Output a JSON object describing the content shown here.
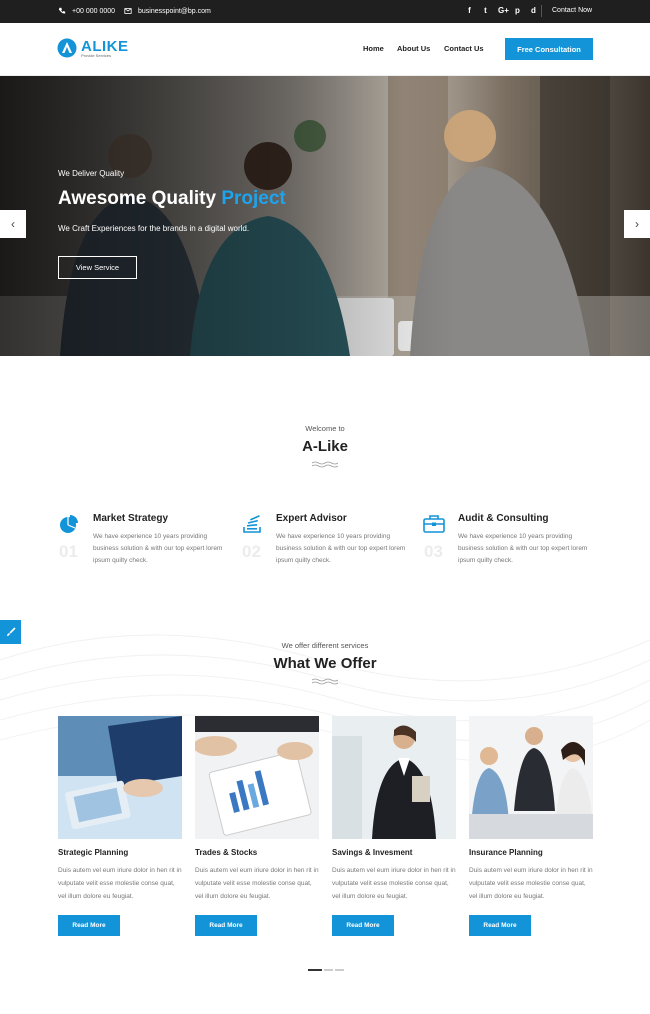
{
  "topbar": {
    "phone": "+00 000 0000",
    "email": "businesspoint@bp.com",
    "socials": [
      "f",
      "t",
      "G+",
      "p",
      "d"
    ],
    "contact": "Contact Now"
  },
  "header": {
    "brand": "ALIKE",
    "tagline": "Provide Services",
    "nav": [
      "Home",
      "About Us",
      "Contact Us"
    ],
    "cta": "Free Consultation"
  },
  "hero": {
    "eyebrow": "We Deliver Quality",
    "title_main": "Awesome Quality ",
    "title_accent": "Project",
    "subtitle": "We Craft Experiences for the brands in a digital world.",
    "button": "View Service",
    "prev": "‹",
    "next": "›"
  },
  "welcome": {
    "small": "Welcome to",
    "title": "A-Like"
  },
  "features": [
    {
      "num": "01",
      "title": "Market Strategy",
      "desc": "We have experience 10 years providing business solution & with our top expert lorem ipsum quilty check.",
      "icon": "pie-chart-icon"
    },
    {
      "num": "02",
      "title": "Expert Advisor",
      "desc": "We have experience 10 years providing business solution & with our top expert lorem ipsum quilty check.",
      "icon": "stack-icon"
    },
    {
      "num": "03",
      "title": "Audit & Consulting",
      "desc": "We have experience 10 years providing business solution & with our top expert lorem ipsum quilty check.",
      "icon": "briefcase-icon"
    }
  ],
  "offer": {
    "small": "We offer different services",
    "title": "What We Offer"
  },
  "cards": [
    {
      "title": "Strategic Planning",
      "desc": "Duis autem vel eum iriure dolor in hen rit in vulputate velit esse molestie conse quat, vel illum dolore eu feugiat.",
      "button": "Read More"
    },
    {
      "title": "Trades & Stocks",
      "desc": "Duis autem vel eum iriure dolor in hen rit in vulputate velit esse molestie conse quat, vel illum dolore eu feugiat.",
      "button": "Read More"
    },
    {
      "title": "Savings & Invesment",
      "desc": "Duis autem vel eum iriure dolor in hen rit in vulputate velit esse molestie conse quat, vel illum dolore eu feugiat.",
      "button": "Read More"
    },
    {
      "title": "Insurance Planning",
      "desc": "Duis autem vel eum iriure dolor in hen rit in vulputate velit esse molestie conse quat, vel illum dolore eu feugiat.",
      "button": "Read More"
    }
  ],
  "colors": {
    "accent": "#1394d8",
    "dark": "#1f1f1f"
  }
}
